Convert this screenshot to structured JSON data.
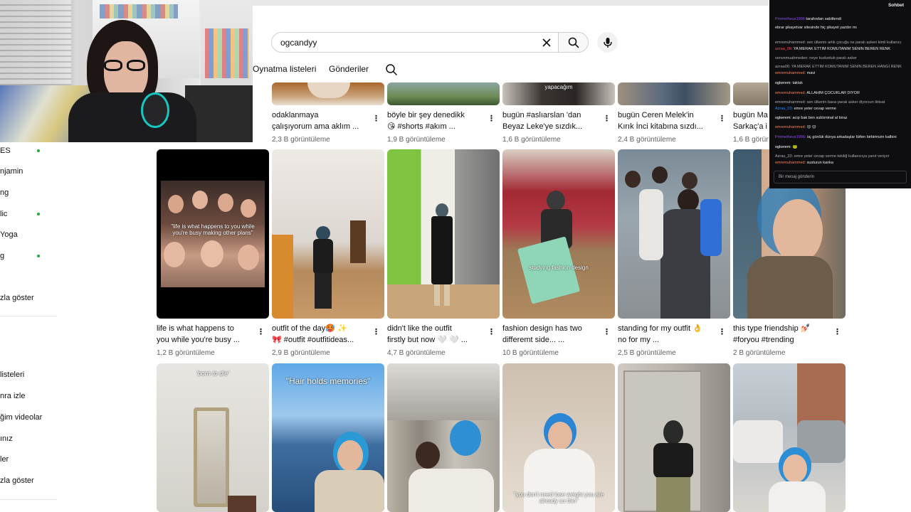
{
  "search": {
    "query": "ogcandyy"
  },
  "tabs": [
    {
      "label": "Oynatma listeleri"
    },
    {
      "label": "Gönderiler"
    }
  ],
  "sidebar": {
    "items": [
      {
        "label": "ES"
      },
      {
        "label": "njamin"
      },
      {
        "label": "ng"
      },
      {
        "label": "lic"
      },
      {
        "label": "Yoga"
      },
      {
        "label": "g"
      },
      {
        "label": "zla göster"
      },
      {
        "label": "listeleri"
      },
      {
        "label": "nra izle"
      },
      {
        "label": "ğim videolar"
      },
      {
        "label": "ınız"
      },
      {
        "label": "ler"
      },
      {
        "label": "zla göster"
      }
    ],
    "dot_color": "#2ba640"
  },
  "rows": [
    {
      "videos": [
        {
          "line1": "odaklanmaya",
          "line2": "çalışıyorum ama aklım ...",
          "views": "2,3 B görüntüleme",
          "overlay": ""
        },
        {
          "line1": "böyle bir şey denedikk",
          "line2": "😘 #shorts #akım ...",
          "views": "1,9 B görüntüleme",
          "overlay": ""
        },
        {
          "line1": "bugün #aslıarslan 'dan",
          "line2": "Beyaz Leke'ye sızdık...",
          "views": "1,6 B görüntüleme",
          "overlay": "yapacağım"
        },
        {
          "line1": "bugün Ceren Melek'in",
          "line2": "Kırık İnci kitabına sızdı...",
          "views": "2,4 B görüntüleme",
          "overlay": ""
        },
        {
          "line1": "bugün Ma",
          "line2": "Sarkaç'a i",
          "views": "1,6 B görüntüleme",
          "overlay": ""
        }
      ]
    },
    {
      "videos": [
        {
          "line1": "life is what happens to",
          "line2": "you while you're busy ...",
          "views": "1,2 B görüntüleme",
          "overlay": "\"life is what happens to you while you're busy making other plans\""
        },
        {
          "line1": "outfit of the day🥵 ✨",
          "line2": "🎀 #outfit #outfitideas...",
          "views": "2,9 B görüntüleme",
          "overlay": ""
        },
        {
          "line1": "didn't like the outfit",
          "line2": "firstly but now 🤍 🤍 ...",
          "views": "4,7 B görüntüleme",
          "overlay": ""
        },
        {
          "line1": "fashion design has two",
          "line2": "differemt side... ...",
          "views": "10 B görüntüleme",
          "overlay": "studying fashion design"
        },
        {
          "line1": "standing for my outfit 👌",
          "line2": "no for my ...",
          "views": "2,5 B görüntüleme",
          "overlay": ""
        },
        {
          "line1": "this type friendship 💅🏻",
          "line2": "#foryou #trending",
          "views": "2 B görüntüleme",
          "overlay": ""
        }
      ]
    },
    {
      "videos": [
        {
          "overlay": "'born to die'"
        },
        {
          "overlay": "\"Hair holds memories\""
        },
        {
          "overlay": ""
        },
        {
          "overlay": "\"you don't need lose weight you are already so thin\""
        },
        {
          "overlay": ""
        },
        {
          "overlay": ""
        }
      ]
    }
  ],
  "webcam": {
    "label": ""
  },
  "chat": {
    "header": "Sohbet",
    "pinned_user": "Prometheus1996",
    "pinned_suffix": "tarafından sabitlendi",
    "pinned_text": "ebrar şikayetvar sitesinde hiç şikayet yazdın mı",
    "messages": [
      {
        "user": "",
        "text": "emremuhammed: sen ülkenin artık çocuğu ne paralı askeri kimli kullanıcı",
        "color": "#adadb8"
      },
      {
        "user": "azraa_06:",
        "text": "YA MERAK ETTİM KOMUTANIM SENİN BEREN RENK",
        "color": "#ff4f4f"
      },
      {
        "user": "",
        "text": "senvemuahmeden: neye kudurdub paralı asker",
        "color": "#adadb8"
      },
      {
        "user": "",
        "text": "azraa06: YA MERAK ETTİM KOMUTANIM SENİN BEREN HANGİ RENK",
        "color": "#adadb8"
      },
      {
        "user": "emremuhammed:",
        "text": "mavi",
        "color": "#ff7f50"
      },
      {
        "user": "ogkerem:",
        "text": "taktsk",
        "color": "#ffffff"
      },
      {
        "user": "emremuhammed:",
        "text": "ALLAHIM ÇOCUKLAR DİYOR",
        "color": "#ff7f50"
      },
      {
        "user": "",
        "text": "emremuhammed: sen ülkenin bana paralı asker diyorsun iktisat",
        "color": "#adadb8"
      },
      {
        "user": "Azrau_03:",
        "text": "emre yeter cevap verme",
        "color": "#1e90ff"
      },
      {
        "user": "ogkerem:",
        "text": "acıp bak ben sublıminal al biraz",
        "color": "#ffffff"
      },
      {
        "user": "emremuhammed:",
        "text": "😊 😊",
        "color": "#ff7f50"
      },
      {
        "user": "Prometheus1996:",
        "text": "üç günlük dünya arkadaşlar lütfen birbirinizin kalbini",
        "color": "#9147ff"
      },
      {
        "user": "ogkerem:",
        "text": "🐸",
        "color": "#ffffff"
      },
      {
        "user": "",
        "text": "Azrau_33: emre yeter cevap verme tekiliğ kullanıcıya yanıt veriyor",
        "color": "#adadb8"
      },
      {
        "user": "emremuhammed:",
        "text": "susturun kanka",
        "color": "#ff7f50"
      }
    ],
    "input_placeholder": "Bir mesaj gönderin"
  }
}
